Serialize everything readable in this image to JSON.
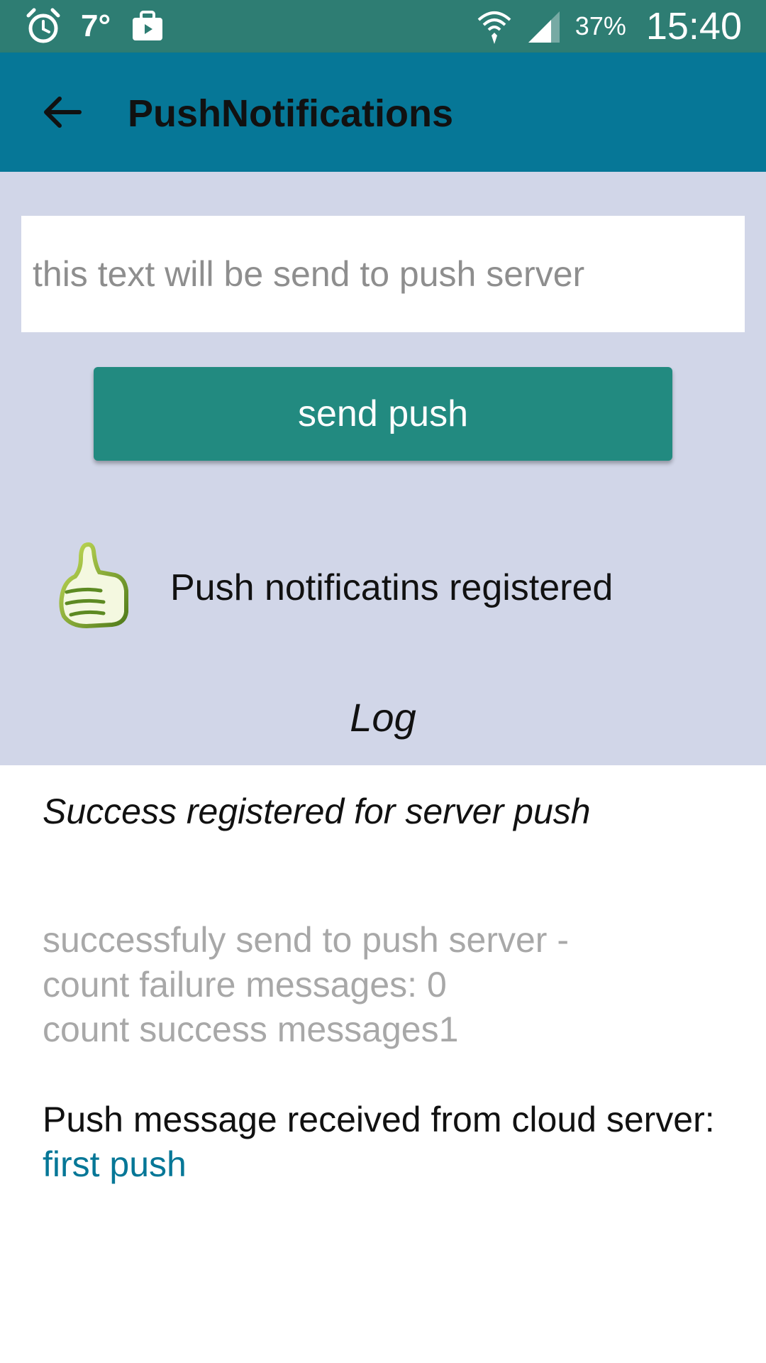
{
  "status_bar": {
    "temperature": "7°",
    "battery": "37%",
    "time": "15:40",
    "icons": [
      "alarm-icon",
      "weather-icon",
      "briefcase-icon",
      "wifi-icon",
      "signal-icon"
    ]
  },
  "app_bar": {
    "title": "PushNotifications",
    "back_icon": "arrow-back-icon"
  },
  "form": {
    "input_placeholder": "this text will be send to push server",
    "input_value": "",
    "send_label": "send push"
  },
  "registration": {
    "icon": "thumbs-up-icon",
    "status_text": "Push notificatins registered"
  },
  "log": {
    "title": "Log",
    "entries": {
      "registered": "Success registered for server push",
      "send_result": "successfuly send to push server -\ncount failure messages: 0\ncount success messages1",
      "received_prefix": "Push message received from cloud server: ",
      "received_message": "first push"
    }
  },
  "colors": {
    "status_bar": "#2e7d73",
    "app_bar": "#067797",
    "content_background": "#d1d6e8",
    "button": "#228a80",
    "highlight_text": "#067797",
    "muted_text": "#a8a8a8"
  }
}
